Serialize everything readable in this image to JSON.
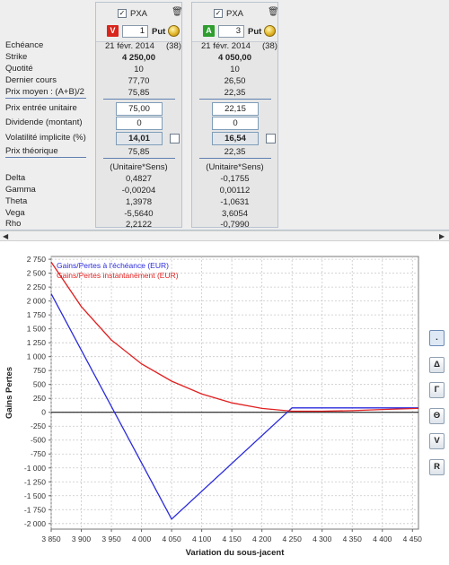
{
  "labels": {
    "echeance": "Echéance",
    "strike": "Strike",
    "quotite": "Quotité",
    "dernier_cours": "Dernier cours",
    "prix_moyen": "Prix moyen : (A+B)/2",
    "prix_entree": "Prix entrée unitaire",
    "dividende": "Dividende (montant)",
    "volatilite": "Volatilité implicite (%)",
    "prix_theorique": "Prix théorique",
    "delta": "Delta",
    "gamma": "Gamma",
    "theta": "Theta",
    "vega": "Vega",
    "rho": "Rho"
  },
  "options": [
    {
      "checked": "✓",
      "underlying": "PXA",
      "side": "V",
      "side_color": "#d9261c",
      "quantity": "1",
      "type": "Put",
      "expiry": "21 févr. 2014",
      "days": "(38)",
      "strike": "4 250,00",
      "quotite": "10",
      "dernier_cours": "77,70",
      "prix_moyen": "75,85",
      "prix_entree": "75,00",
      "dividende": "0",
      "volatilite": "14,01",
      "prix_theorique": "75,85",
      "unit_note": "(Unitaire*Sens)",
      "delta": "0,4827",
      "gamma": "-0,00204",
      "theta": "1,3978",
      "vega": "-5,5640",
      "rho": "2,2122"
    },
    {
      "checked": "✓",
      "underlying": "PXA",
      "side": "A",
      "side_color": "#2e9e2e",
      "quantity": "3",
      "type": "Put",
      "expiry": "21 févr. 2014",
      "days": "(38)",
      "strike": "4 050,00",
      "quotite": "10",
      "dernier_cours": "26,50",
      "prix_moyen": "22,35",
      "prix_entree": "22,15",
      "dividende": "0",
      "volatilite": "16,54",
      "prix_theorique": "22,35",
      "unit_note": "(Unitaire*Sens)",
      "delta": "-0,1755",
      "gamma": "0,00112",
      "theta": "-1,0631",
      "vega": "3,6054",
      "rho": "-0,7990"
    }
  ],
  "scroll": {
    "left": "◀",
    "right": "▶"
  },
  "side_buttons": [
    ".",
    "Δ",
    "Γ",
    "Θ",
    "V",
    "R"
  ],
  "chart_data": {
    "type": "line",
    "xlabel": "Variation du sous-jacent",
    "ylabel": "Gains Pertes",
    "xlim": [
      3850,
      4460
    ],
    "ylim": [
      -2100,
      2800
    ],
    "x_ticks": [
      3850,
      3900,
      3950,
      4000,
      4050,
      4100,
      4150,
      4200,
      4250,
      4300,
      4350,
      4400,
      4450
    ],
    "x_tick_labels": [
      "3 850",
      "3 900",
      "3 950",
      "4 000",
      "4 050",
      "4 100",
      "4 150",
      "4 200",
      "4 250",
      "4 300",
      "4 350",
      "4 400",
      "4 450"
    ],
    "y_ticks": [
      2750,
      2500,
      2250,
      2000,
      1750,
      1500,
      1250,
      1000,
      750,
      500,
      250,
      0,
      -250,
      -500,
      -750,
      -1000,
      -1250,
      -1500,
      -1750,
      -2000
    ],
    "y_tick_labels": [
      "2 750",
      "2 500",
      "2 250",
      "2 000",
      "1 750",
      "1 500",
      "1 250",
      "1 000",
      "750",
      "500",
      "250",
      "0",
      "-250",
      "-500",
      "-750",
      "-1 000",
      "-1 250",
      "-1 500",
      "-1 750",
      "-2 000"
    ],
    "legend_position": "top-left",
    "grid": true,
    "series": [
      {
        "name": "Gains/Pertes à l'échéance (EUR)",
        "color": "#2b2bdc",
        "x": [
          3850,
          4050,
          4250,
          4460
        ],
        "y": [
          2130,
          -1920,
          80,
          80
        ]
      },
      {
        "name": "Gains/Pertes instantanément (EUR)",
        "color": "#e02020",
        "x": [
          3850,
          3900,
          3950,
          4000,
          4050,
          4100,
          4150,
          4200,
          4250,
          4300,
          4350,
          4400,
          4460
        ],
        "y": [
          2700,
          1900,
          1300,
          870,
          560,
          330,
          170,
          70,
          20,
          20,
          30,
          50,
          70
        ]
      }
    ]
  }
}
